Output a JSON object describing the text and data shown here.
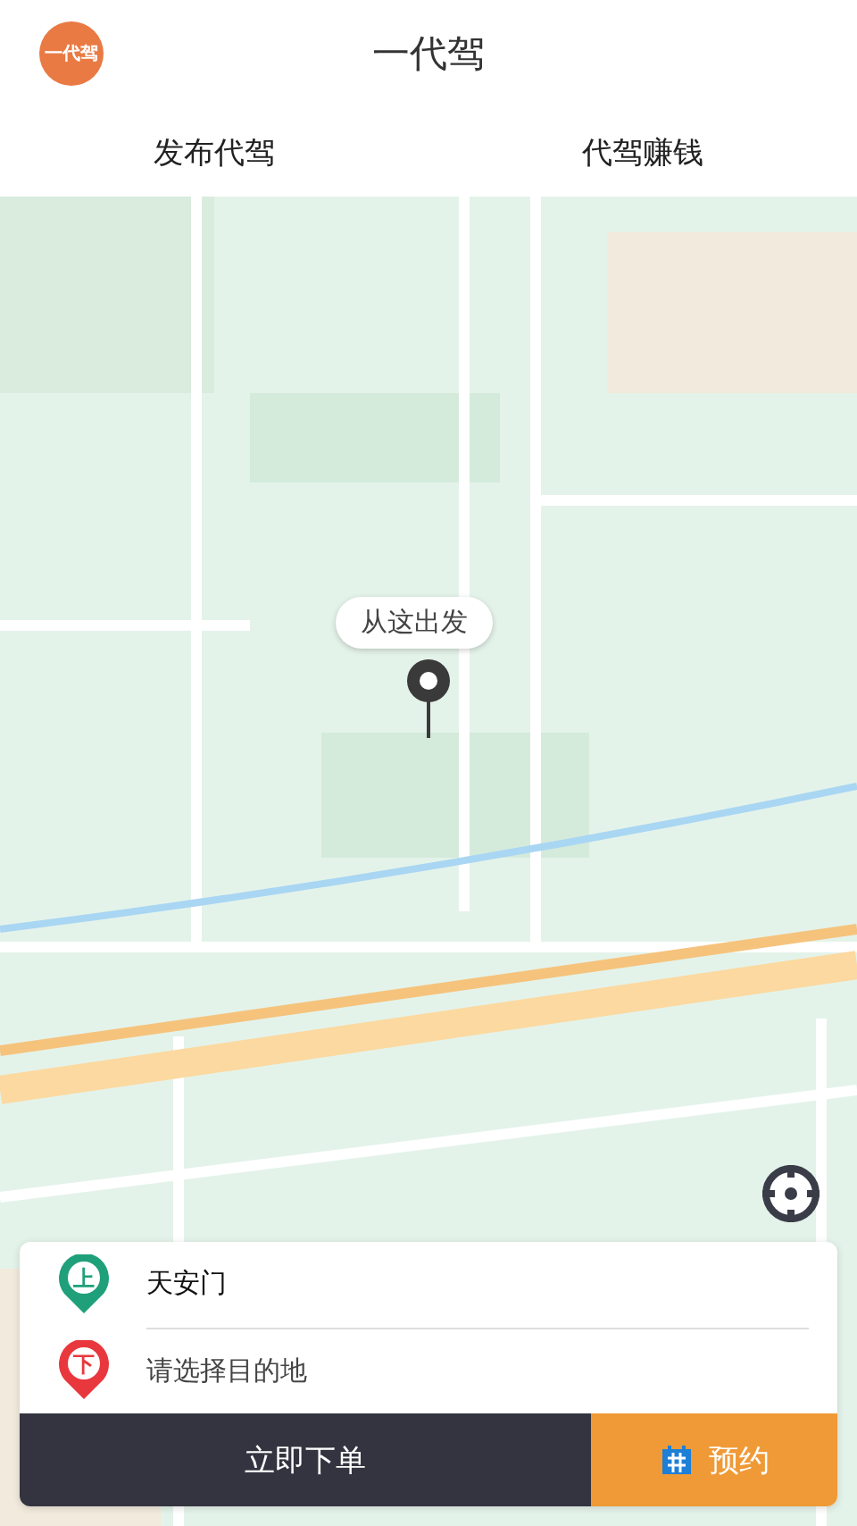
{
  "header": {
    "logo": "一代驾",
    "title": "一代驾"
  },
  "tabs": [
    {
      "label": "发布代驾"
    },
    {
      "label": "代驾赚钱"
    }
  ],
  "map": {
    "bubble": "从这出发"
  },
  "route": [
    {
      "kind": "pickup",
      "badge": "上",
      "text": "天安门",
      "color": "#1fa07a"
    },
    {
      "kind": "dropoff",
      "badge": "下",
      "text": "请选择目的地",
      "color": "#e8383d"
    }
  ],
  "actions": [
    {
      "kind": "primary",
      "label": "立即下单"
    },
    {
      "kind": "schedule",
      "label": "预约"
    }
  ]
}
